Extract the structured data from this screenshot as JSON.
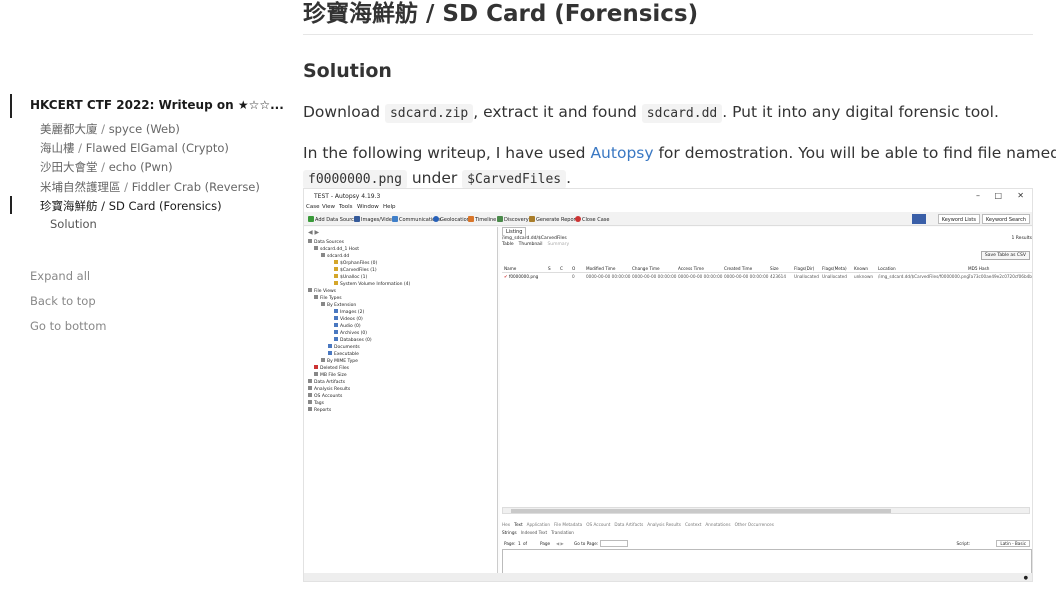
{
  "toc": {
    "top_item": "HKCERT CTF 2022: Writeup on ★☆☆...",
    "items": [
      {
        "zh": "美麗都大廈",
        "sep": " / ",
        "en": "spyce (Web)"
      },
      {
        "zh": "海山樓",
        "sep": " / ",
        "en": "Flawed ElGamal (Crypto)"
      },
      {
        "zh": "沙田大會堂",
        "sep": " / ",
        "en": "echo (Pwn)"
      },
      {
        "zh": "米埔自然護理區",
        "sep": " / ",
        "en": "Fiddler Crab (Reverse)"
      },
      {
        "zh": "珍寶海鮮舫",
        "sep": " / ",
        "en": "SD Card (Forensics)"
      }
    ],
    "subitem": "Solution",
    "expand_all": "Expand all",
    "back_to_top": "Back to top",
    "go_to_bottom": "Go to bottom"
  },
  "article": {
    "title": "珍寶海鮮舫 / SD Card (Forensics)",
    "section": "Solution",
    "p1": {
      "t1": "Download ",
      "c1": "sdcard.zip",
      "t2": ", extract it and found ",
      "c2": "sdcard.dd",
      "t3": ". Put it into any digital forensic tool."
    },
    "p2": {
      "t1": "In the following writeup, I have used ",
      "link": "Autopsy",
      "t2": " for demostration. You will be able to find file named",
      "c1": "f0000000.png",
      "t3": " under ",
      "c2": "$CarvedFiles",
      "t4": "."
    }
  },
  "screenshot": {
    "window_title": "TEST - Autopsy 4.19.3",
    "window_controls": [
      "–",
      "□",
      "✕"
    ],
    "menu": [
      "Case",
      "View",
      "Tools",
      "Window",
      "Help"
    ],
    "toolbar": [
      "Add Data Source",
      "Images/Videos",
      "Communications",
      "Geolocation",
      "Timeline",
      "Discovery",
      "Generate Report",
      "Close Case"
    ],
    "keyword_lists": "Keyword Lists",
    "keyword_search": "Keyword Search",
    "tree": [
      "Data Sources",
      "sdcard.dd_1 Host",
      "sdcard.dd",
      "$OrphanFiles (0)",
      "$CarvedFiles (1)",
      "$Unalloc (1)",
      "System Volume Information (4)",
      "File Views",
      "File Types",
      "By Extension",
      "Images (2)",
      "Videos (0)",
      "Audio (0)",
      "Archives (0)",
      "Databases (0)",
      "Documents",
      "Executable",
      "By MIME Type",
      "Deleted Files",
      "MB File Size",
      "Data Artifacts",
      "Analysis Results",
      "OS Accounts",
      "Tags",
      "Reports"
    ],
    "listing_tab": "Listing",
    "listing_path": "/img_sdcard.dd/$CarvedFiles",
    "results_count": "1 Results",
    "view_tabs": [
      "Table",
      "Thumbnail",
      "Summary"
    ],
    "save_table": "Save Table as CSV",
    "columns": [
      "Name",
      "S",
      "C",
      "O",
      "Modified Time",
      "Change Time",
      "Access Time",
      "Created Time",
      "Size",
      "Flags(Dir)",
      "Flags(Meta)",
      "Known",
      "Location",
      "MD5 Hash"
    ],
    "row": [
      "f0000000.png",
      "",
      "",
      "0",
      "0000-00-00 00:00:00",
      "0000-00-00 00:00:00",
      "0000-00-00 00:00:00",
      "0000-00-00 00:00:00",
      "423614",
      "Unallocated",
      "Unallocated",
      "unknown",
      "/img_sdcard.dd/$CarvedFiles/f0000000.png",
      "7a73c00ae49e2c0720cf06b4b70c"
    ],
    "content_tabs": [
      "Hex",
      "Text",
      "Application",
      "File Metadata",
      "OS Account",
      "Data Artifacts",
      "Analysis Results",
      "Context",
      "Annotations",
      "Other Occurrences"
    ],
    "text_subtabs": [
      "Strings",
      "Indexed Text",
      "Translation"
    ],
    "pager": {
      "page_label": "Page:",
      "page_value": "1",
      "of_label": "of",
      "page_word": "Page",
      "goto": "Go to Page:",
      "script_label": "Script:",
      "script_value": "Latin - Basic"
    }
  }
}
